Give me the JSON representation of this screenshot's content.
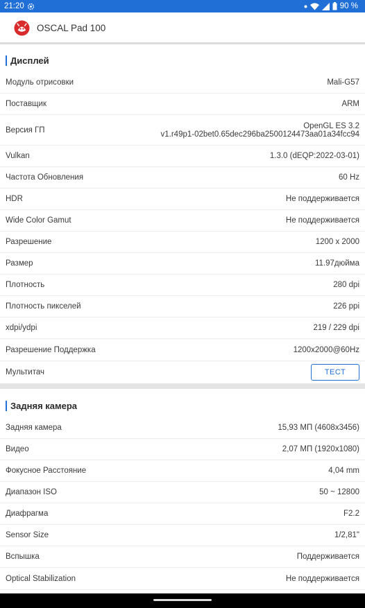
{
  "status_bar": {
    "time": "21:20",
    "battery": "90 %",
    "icons": [
      "settings-gear-icon",
      "wifi-icon",
      "signal-icon",
      "battery-icon"
    ]
  },
  "header": {
    "title": "OSCAL Pad 100",
    "logo": "antutu-logo"
  },
  "display": {
    "title": "Дисплей",
    "rows": [
      {
        "label": "Модуль отрисовки",
        "value": "Mali-G57"
      },
      {
        "label": "Поставщик",
        "value": "ARM"
      },
      {
        "label": "Версия ГП",
        "value": "OpenGL ES 3.2",
        "value2": "v1.r49p1-02bet0.65dec296ba2500124473aa01a34fcc94"
      },
      {
        "label": "Vulkan",
        "value": "1.3.0 (dEQP:2022-03-01)"
      },
      {
        "label": "Частота Обновления",
        "value": "60 Hz"
      },
      {
        "label": "HDR",
        "value": "Не поддерживается"
      },
      {
        "label": "Wide Color Gamut",
        "value": "Не поддерживается"
      },
      {
        "label": "Разрешение",
        "value": "1200 x 2000"
      },
      {
        "label": "Размер",
        "value": "11.97дюйма"
      },
      {
        "label": "Плотность",
        "value": "280 dpi"
      },
      {
        "label": "Плотность пикселей",
        "value": "226 ppi"
      },
      {
        "label": "xdpi/ydpi",
        "value": "219 / 229 dpi"
      },
      {
        "label": "Разрешение Поддержка",
        "value": "1200x2000@60Hz"
      },
      {
        "label": "Мультитач",
        "button": "ТЕСТ"
      }
    ]
  },
  "camera": {
    "title": "Задняя камера",
    "rows": [
      {
        "label": "Задняя камера",
        "value": "15,93 МП (4608x3456)"
      },
      {
        "label": "Видео",
        "value": "2,07 МП (1920x1080)"
      },
      {
        "label": "Фокусное Расстояние",
        "value": "4,04 mm"
      },
      {
        "label": "Диапазон ISO",
        "value": "50 ~ 12800"
      },
      {
        "label": "Диафрагма",
        "value": "F2.2"
      },
      {
        "label": "Sensor Size",
        "value": "1/2,81\""
      },
      {
        "label": "Вспышка",
        "value": "Поддерживается"
      },
      {
        "label": "Optical Stabilization",
        "value": "Не поддерживается"
      }
    ]
  }
}
